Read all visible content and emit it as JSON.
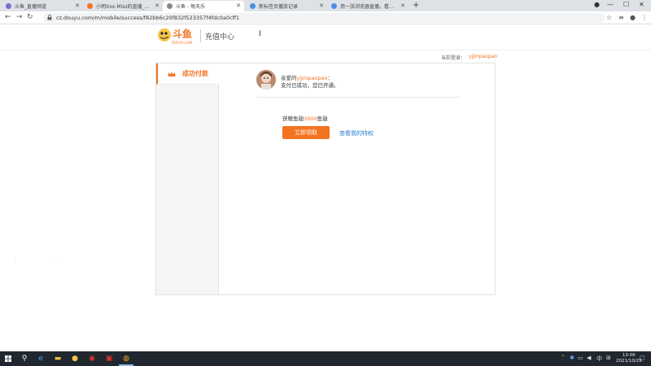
{
  "browser": {
    "tabs": [
      {
        "title": "斗鱼_直播频道",
        "active": false
      },
      {
        "title": "小明Xxx-Miss的直播_斗地...",
        "active": false
      },
      {
        "title": "斗鱼 - 每天乐",
        "active": true
      },
      {
        "title": "新标签页播放记录",
        "active": false
      },
      {
        "title": "用一张浏览器直播，看一场直播...",
        "active": false
      }
    ],
    "url": "cz.douyu.com/m/mobile/success/f82bb6c20f832f523357f4fdc0a0cff1"
  },
  "header": {
    "logo_text": "斗鱼",
    "logo_sub": "DOUYU.COM",
    "title": "充值中心",
    "login_label": "当前登录：",
    "login_user": "yjjmpaopao"
  },
  "sidebar": {
    "items": [
      {
        "label": "成功付款"
      }
    ]
  },
  "main": {
    "welcome_prefix": "亲爱的",
    "welcome_user": "yjjmpaopao",
    "welcome_suffix": "：",
    "paid_message": "支付已成功，您已开通。",
    "gift_prefix": "获赠鱼翅",
    "gift_amount": "3000",
    "gift_suffix": "鱼翅",
    "recharge_button": "立即领取",
    "privilege_link": "查看我的特权"
  },
  "taskbar": {
    "time": "13:06",
    "date": "2021/10/29"
  },
  "colors": {
    "accent": "#f47321",
    "link": "#2a7fd4"
  }
}
